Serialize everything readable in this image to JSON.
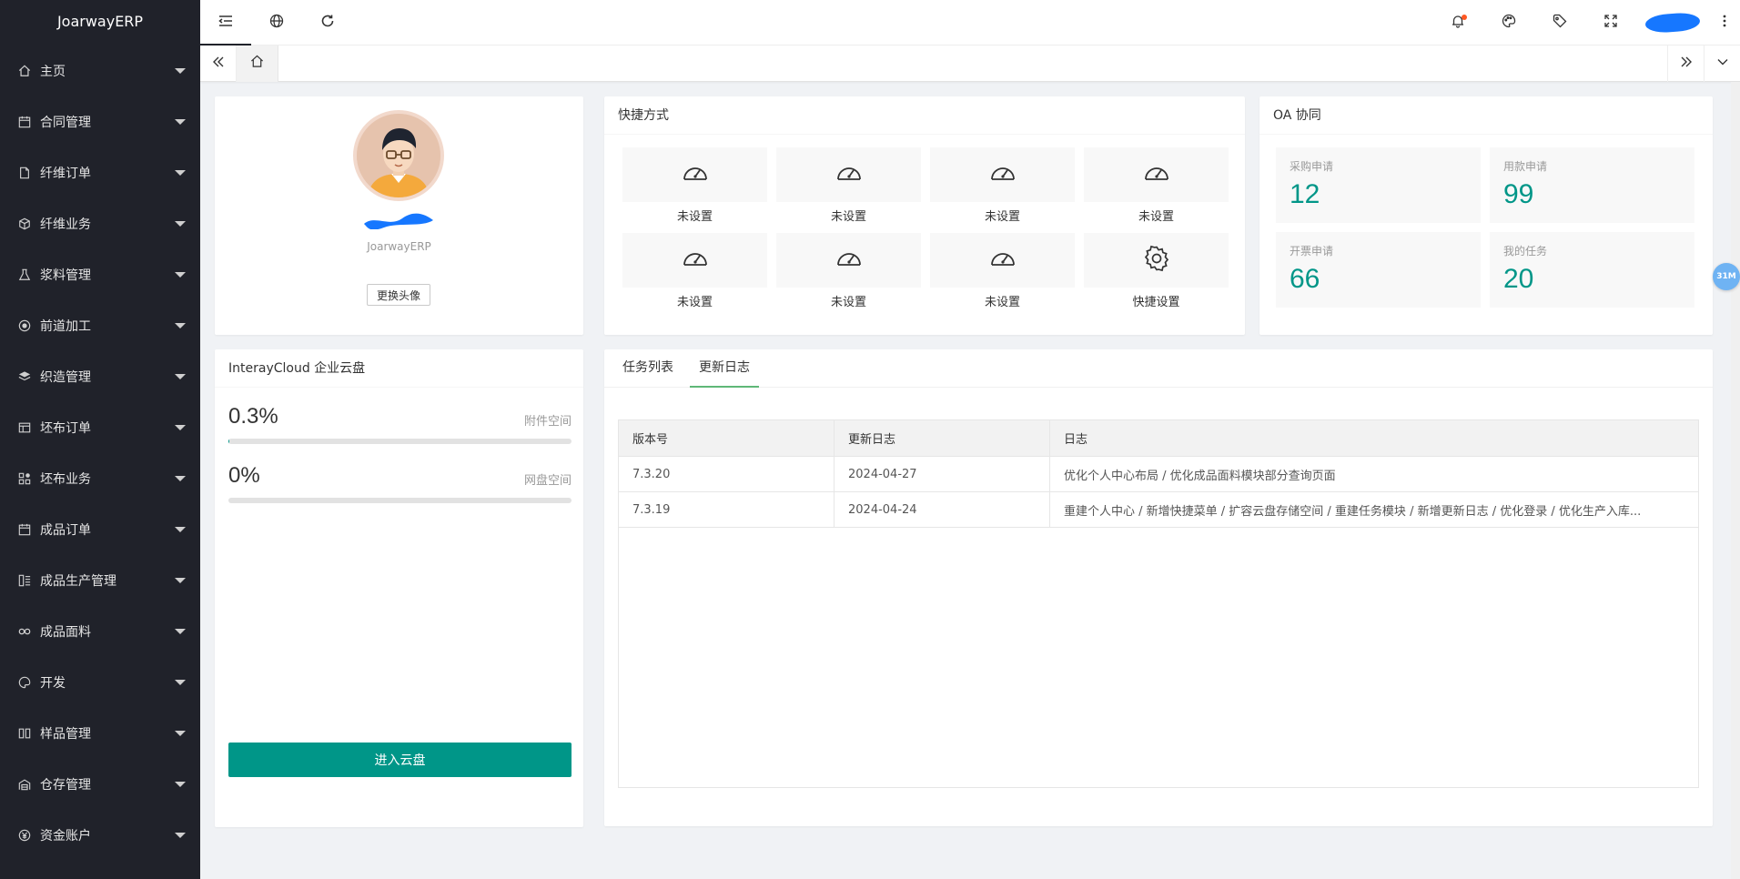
{
  "app": {
    "title": "JoarwayERP"
  },
  "sidebar": {
    "items": [
      {
        "label": "主页",
        "icon": "home-icon"
      },
      {
        "label": "合同管理",
        "icon": "calendar-icon"
      },
      {
        "label": "纤维订单",
        "icon": "file-icon"
      },
      {
        "label": "纤维业务",
        "icon": "cube-icon"
      },
      {
        "label": "浆料管理",
        "icon": "flask-icon"
      },
      {
        "label": "前道加工",
        "icon": "target-icon"
      },
      {
        "label": "织造管理",
        "icon": "layers-icon"
      },
      {
        "label": "坯布订单",
        "icon": "table-icon"
      },
      {
        "label": "坯布业务",
        "icon": "grid-icon"
      },
      {
        "label": "成品订单",
        "icon": "calendar-icon"
      },
      {
        "label": "成品生产管理",
        "icon": "list-icon"
      },
      {
        "label": "成品面料",
        "icon": "link-icon"
      },
      {
        "label": "开发",
        "icon": "palette-icon"
      },
      {
        "label": "样品管理",
        "icon": "columns-icon"
      },
      {
        "label": "仓存管理",
        "icon": "warehouse-icon"
      },
      {
        "label": "资金账户",
        "icon": "yen-icon"
      }
    ]
  },
  "header": {
    "left_icons": [
      "menu-collapse-icon",
      "globe-icon",
      "refresh-icon"
    ],
    "right_icons": [
      "bell-icon",
      "palette-icon",
      "tag-icon",
      "fullscreen-icon"
    ],
    "notification_dot_color": "#ff5722",
    "user_blob_color": "#1677ff"
  },
  "profile": {
    "subtitle": "JoarwayERP",
    "change_avatar_label": "更换头像"
  },
  "shortcuts": {
    "title": "快捷方式",
    "items": [
      {
        "label": "未设置",
        "icon": "dashboard-icon"
      },
      {
        "label": "未设置",
        "icon": "dashboard-icon"
      },
      {
        "label": "未设置",
        "icon": "dashboard-icon"
      },
      {
        "label": "未设置",
        "icon": "dashboard-icon"
      },
      {
        "label": "未设置",
        "icon": "dashboard-icon"
      },
      {
        "label": "未设置",
        "icon": "dashboard-icon"
      },
      {
        "label": "未设置",
        "icon": "dashboard-icon"
      },
      {
        "label": "快捷设置",
        "icon": "gear-icon"
      }
    ]
  },
  "oa": {
    "title": "OA 协同",
    "items": [
      {
        "label": "采购申请",
        "value": "12"
      },
      {
        "label": "用款申请",
        "value": "99"
      },
      {
        "label": "开票申请",
        "value": "66"
      },
      {
        "label": "我的任务",
        "value": "20"
      }
    ],
    "accent": "#009688"
  },
  "cloud": {
    "title": "InterayCloud 企业云盘",
    "attachment": {
      "percent_text": "0.3%",
      "label": "附件空间",
      "fill": 0.003
    },
    "netdisk": {
      "percent_text": "0%",
      "label": "网盘空间",
      "fill": 0
    },
    "button_label": "进入云盘"
  },
  "log_panel": {
    "tabs": [
      {
        "label": "任务列表",
        "active": false
      },
      {
        "label": "更新日志",
        "active": true
      }
    ],
    "columns": [
      "版本号",
      "更新日志",
      "日志"
    ],
    "rows": [
      [
        "7.3.20",
        "2024-04-27",
        "优化个人中心布局 / 优化成品面料模块部分查询页面"
      ],
      [
        "7.3.19",
        "2024-04-24",
        "重建个人中心 / 新增快捷菜单 / 扩容云盘存储空间 / 重建任务模块 / 新增更新日志 / 优化登录 / 优化生产入库..."
      ]
    ]
  },
  "float_badge": {
    "label": "31M"
  }
}
